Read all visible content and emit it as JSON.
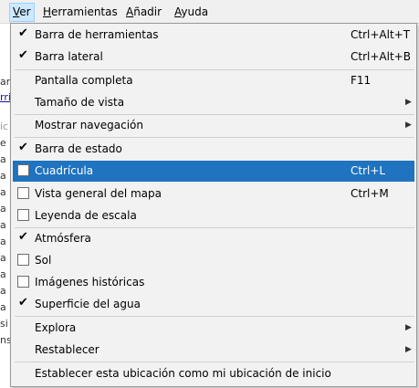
{
  "menubar": {
    "items": [
      {
        "label": "Ver",
        "mnemonic": "V",
        "rest": "er",
        "active": true
      },
      {
        "label": "Herramientas",
        "mnemonic": "H",
        "rest": "erramientas"
      },
      {
        "label": "Añadir",
        "mnemonic": "A",
        "rest": "ñadir"
      },
      {
        "label": "Ayuda",
        "mnemonic": "A",
        "rest": "yuda"
      }
    ]
  },
  "background_page": {
    "lines": [
      "ar",
      "rri",
      "ic",
      "e",
      "a",
      "a",
      "a",
      "a",
      "a",
      "a",
      "a",
      "a",
      "a",
      "a",
      "si",
      "ns t"
    ]
  },
  "menu": {
    "items": [
      {
        "label": "Barra de herramientas",
        "shortcut": "Ctrl+Alt+T",
        "checked": true
      },
      {
        "label": "Barra lateral",
        "shortcut": "Ctrl+Alt+B",
        "checked": true
      },
      {
        "label": "Pantalla completa",
        "shortcut": "F11"
      },
      {
        "label": "Tamaño de vista",
        "submenu": true
      },
      {
        "label": "Mostrar navegación",
        "submenu": true
      },
      {
        "label": "Barra de estado",
        "checked": true
      },
      {
        "label": "Cuadrícula",
        "shortcut": "Ctrl+L",
        "checked": false,
        "highlighted": true
      },
      {
        "label": "Vista general del mapa",
        "shortcut": "Ctrl+M",
        "checked": false
      },
      {
        "label": "Leyenda de escala",
        "checked": false
      },
      {
        "label": "Atmósfera",
        "checked": true
      },
      {
        "label": "Sol",
        "checked": false
      },
      {
        "label": "Imágenes históricas",
        "checked": false
      },
      {
        "label": "Superficie del agua",
        "checked": true
      },
      {
        "label": "Explora",
        "submenu": true
      },
      {
        "label": "Restablecer",
        "submenu": true
      },
      {
        "label": "Establecer esta ubicación como mi ubicación de inicio"
      }
    ],
    "check_glyph": "✔",
    "arrow_glyph": "▶",
    "highlight_color": "#1f73bf"
  }
}
